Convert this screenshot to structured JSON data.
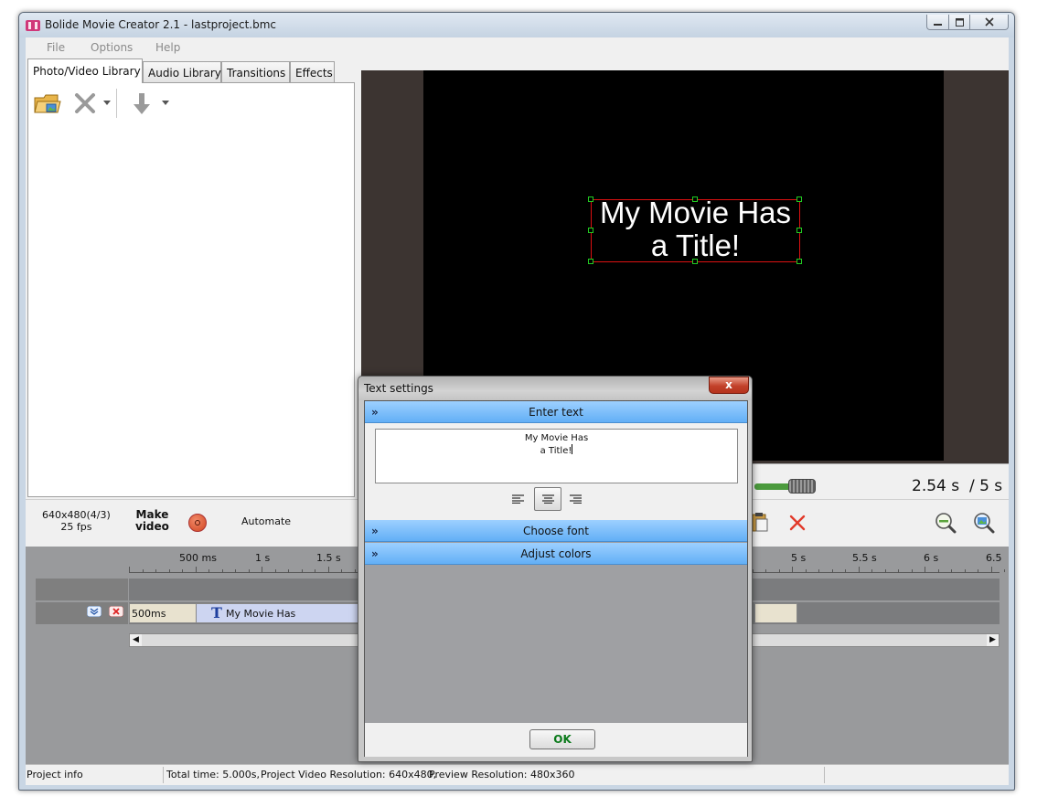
{
  "window": {
    "title": "Bolide Movie Creator 2.1 - lastproject.bmc"
  },
  "menu": {
    "file": "File",
    "options": "Options",
    "help": "Help"
  },
  "tabs": {
    "photo_video": "Photo/Video Library",
    "audio": "Audio Library",
    "transitions": "Transitions",
    "effects": "Effects"
  },
  "preview": {
    "title_line1": "My Movie Has",
    "title_line2": "a Title!",
    "current_time": "2.54 s",
    "total_time": "/ 5 s"
  },
  "project": {
    "resolution": "640x480(4/3)",
    "fps": "25 fps",
    "make_video_line1": "Make",
    "make_video_line2": "video",
    "automate": "Automate"
  },
  "timeline": {
    "ticks": [
      {
        "label": "500 ms"
      },
      {
        "label": "1 s"
      },
      {
        "label": "1.5 s"
      },
      {
        "label": "5 s"
      },
      {
        "label": "5.5 s"
      },
      {
        "label": "6 s"
      },
      {
        "label": "6.5"
      }
    ],
    "gap_label": "500ms",
    "clip_label": "My Movie Has"
  },
  "status": {
    "project_info": "Project info",
    "total_time": "Total time: 5.000s,",
    "project_res": "Project Video Resolution:   640x480,",
    "preview_res": "Preview Resolution:   480x360"
  },
  "dialog": {
    "title": "Text settings",
    "close": "x",
    "enter_text": "Enter text",
    "text_line1": "My Movie Has",
    "text_line2": "a Title!",
    "choose_font": "Choose font",
    "adjust_colors": "Adjust colors",
    "ok": "OK"
  }
}
